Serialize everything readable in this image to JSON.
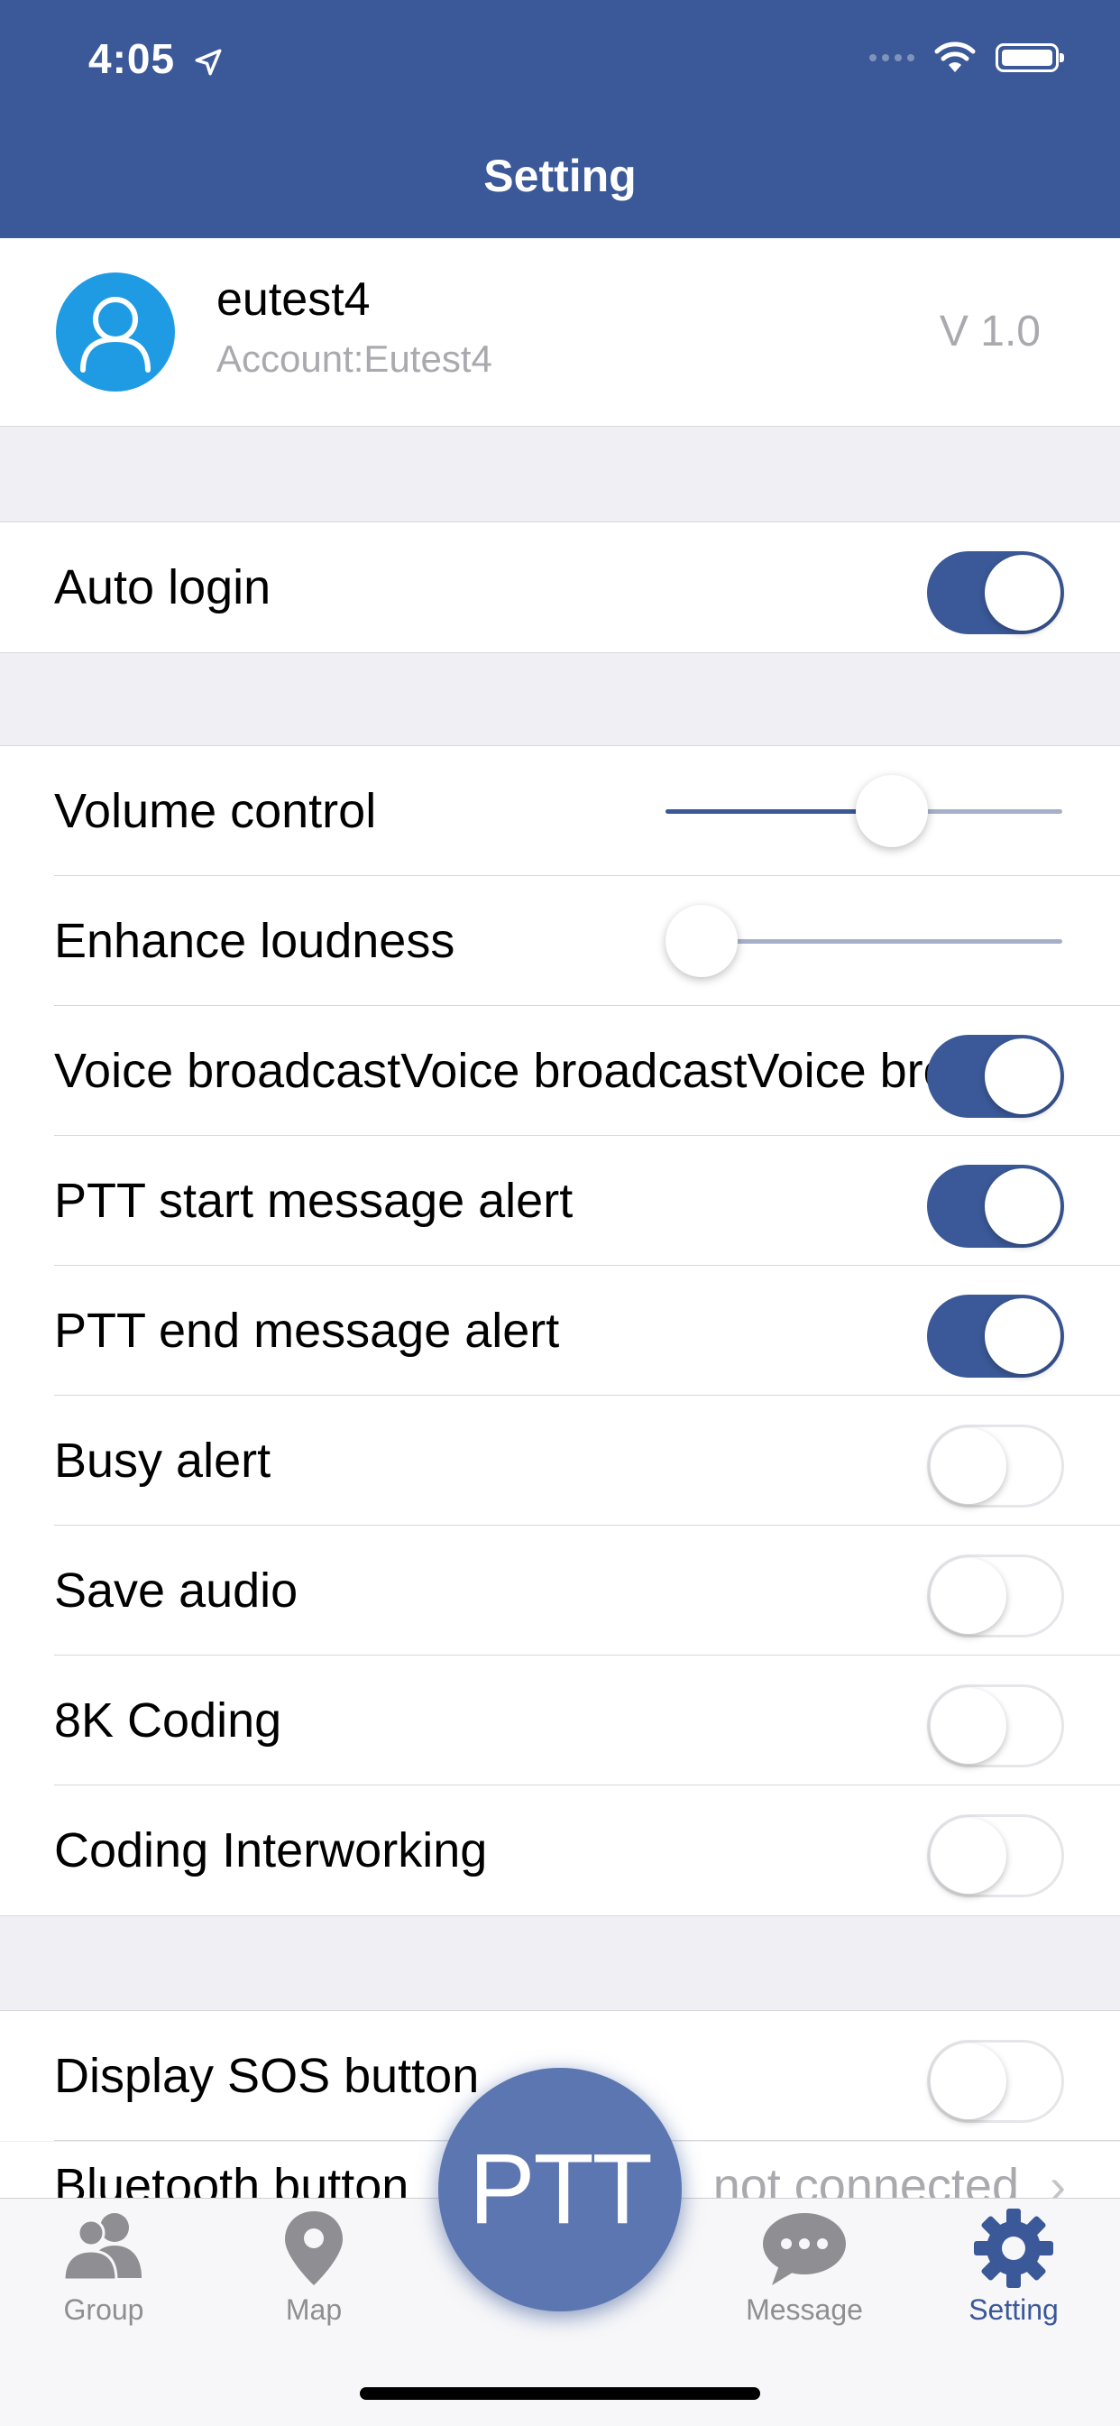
{
  "status_bar": {
    "time": "4:05"
  },
  "nav": {
    "title": "Setting"
  },
  "profile": {
    "name": "eutest4",
    "account": "Account:Eutest4",
    "version": "V 1.0"
  },
  "section1": [
    {
      "label": "Auto login",
      "on": true
    }
  ],
  "section2": {
    "sliders": [
      {
        "label": "Volume control",
        "value": 0.57
      },
      {
        "label": "Enhance loudness",
        "value": 0.09
      }
    ],
    "toggles": [
      {
        "label": "Voice broadcastVoice broadcastVoice broadcast",
        "on": true
      },
      {
        "label": "PTT start message alert",
        "on": true
      },
      {
        "label": "PTT end message alert",
        "on": true
      },
      {
        "label": "Busy alert",
        "on": false
      },
      {
        "label": "Save audio",
        "on": false
      },
      {
        "label": "8K Coding",
        "on": false
      },
      {
        "label": "Coding Interworking",
        "on": false
      }
    ]
  },
  "section3": [
    {
      "label": "Display SOS button",
      "on": false
    }
  ],
  "peek_row": {
    "label": "Bluetooth button",
    "value": "not connected"
  },
  "tabs": [
    {
      "label": "Group",
      "active": false,
      "icon": "group-icon"
    },
    {
      "label": "Map",
      "active": false,
      "icon": "map-pin-icon"
    },
    {
      "label": "Message",
      "active": false,
      "icon": "message-icon"
    },
    {
      "label": "Setting",
      "active": true,
      "icon": "gear-icon"
    }
  ],
  "ptt_button": {
    "label": "PTT"
  },
  "colors": {
    "brand": "#3b5998",
    "avatar": "#1e9be3",
    "inactive_tab": "#8e8e93"
  }
}
